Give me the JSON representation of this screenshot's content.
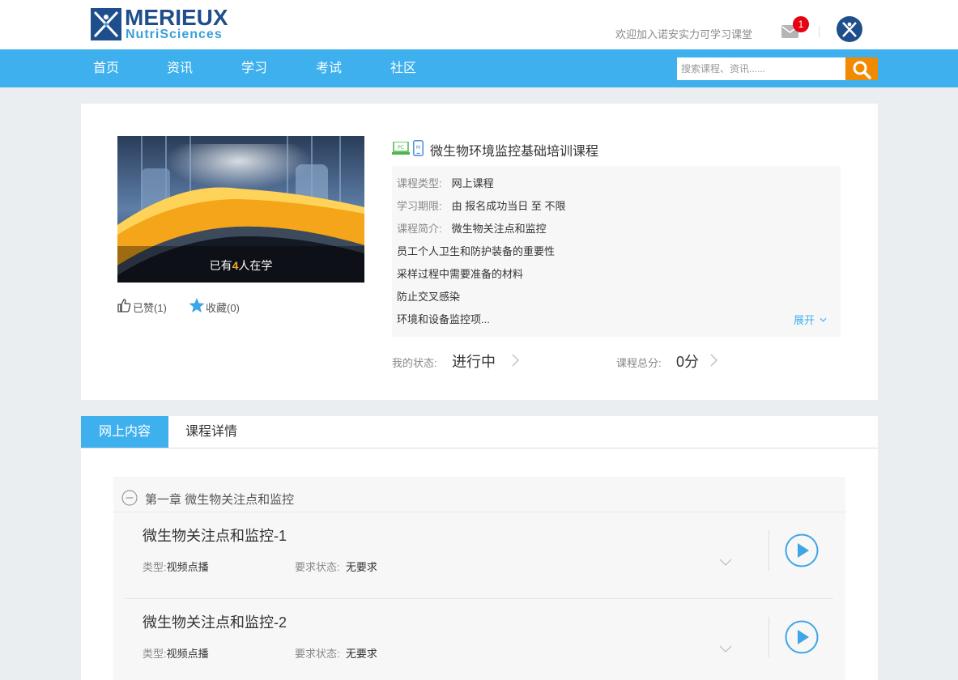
{
  "header": {
    "logo_line1": "MERIEUX",
    "logo_line2": "NutriSciences",
    "welcome": "欢迎加入诺安实力可学习课堂",
    "unread_count": "1"
  },
  "nav": {
    "items": [
      "首页",
      "资讯",
      "学习",
      "考试",
      "社区"
    ],
    "search_placeholder": "搜索课程、资讯......"
  },
  "course": {
    "learners_prefix": "已有",
    "learners_count": "4",
    "learners_suffix": "人在学",
    "like_label": "已赞(1)",
    "favorite_label": "收藏(0)",
    "title": "微生物环境监控基础培训课程",
    "type_label": "课程类型:",
    "type_value": "网上课程",
    "period_label": "学习期限:",
    "period_value": "由 报名成功当日 至 不限",
    "intro_label": "课程简介:",
    "intro_lines": [
      "微生物关注点和监控",
      "员工个人卫生和防护装备的重要性",
      "采样过程中需要准备的材料",
      "防止交叉感染",
      "环境和设备监控项..."
    ],
    "expand_label": "展开",
    "status_label": "我的状态:",
    "status_value": "进行中",
    "score_label": "课程总分:",
    "score_value": "0分"
  },
  "tabs": [
    "网上内容",
    "课程详情"
  ],
  "chapter": {
    "title": "第一章 微生物关注点和监控",
    "lessons": [
      {
        "title": "微生物关注点和监控-1",
        "type_label": "类型:",
        "type_value": "视频点播",
        "req_label": "要求状态:",
        "req_value": "无要求"
      },
      {
        "title": "微生物关注点和监控-2",
        "type_label": "类型:",
        "type_value": "视频点播",
        "req_label": "要求状态:",
        "req_value": "无要求"
      }
    ]
  },
  "colors": {
    "accent": "#3eb0ee",
    "search_button": "#f18a00",
    "badge": "#e60012",
    "highlight_number": "#f5a623"
  },
  "icons": [
    "mail-icon",
    "avatar-icon",
    "search-icon",
    "pc-icon",
    "mobile-icon",
    "thumbs-up-icon",
    "star-icon",
    "chevron-right-icon",
    "chevron-down-icon",
    "minus-circle-icon",
    "play-icon"
  ]
}
